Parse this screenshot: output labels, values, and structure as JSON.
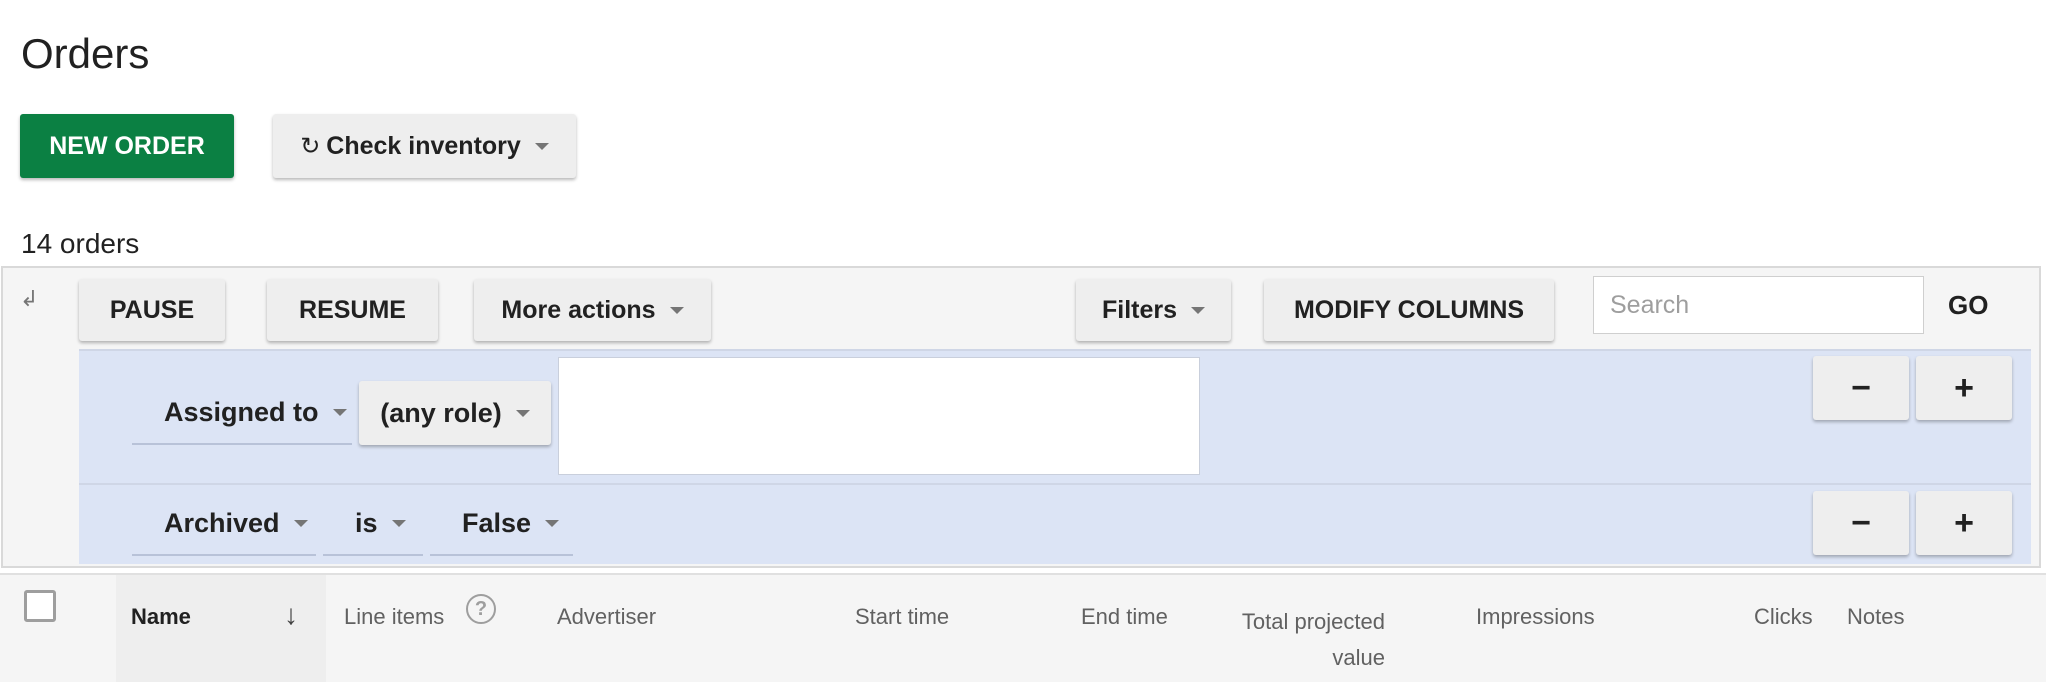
{
  "page": {
    "title": "Orders"
  },
  "toolbar": {
    "new_order_label": "NEW ORDER",
    "check_inventory_label": "Check inventory",
    "refresh_glyph": "↻"
  },
  "orders": {
    "count_label": "14 orders"
  },
  "actions": {
    "pause_label": "PAUSE",
    "resume_label": "RESUME",
    "more_actions_label": "More actions",
    "filters_label": "Filters",
    "modify_columns_label": "MODIFY COLUMNS",
    "search_placeholder": "Search",
    "go_label": "GO"
  },
  "filters": [
    {
      "field": "Assigned to",
      "operator": "(any role)",
      "value": ""
    },
    {
      "field": "Archived",
      "operator": "is",
      "value": "False"
    }
  ],
  "filter_controls": {
    "remove_label": "−",
    "add_label": "+"
  },
  "table": {
    "columns": [
      "Name",
      "Line items",
      "Advertiser",
      "Start time",
      "End time",
      "Total projected value",
      "Impressions",
      "Clicks",
      "Notes"
    ],
    "sort_glyph": "↓",
    "help_glyph": "?"
  },
  "icons": {
    "collapse": "collapse-icon",
    "sort": "arrow-down-icon",
    "help": "help-circle-icon",
    "refresh": "refresh-icon"
  },
  "colors": {
    "primary_button": "#0b8043",
    "filter_row_bg": "#dce4f5"
  }
}
